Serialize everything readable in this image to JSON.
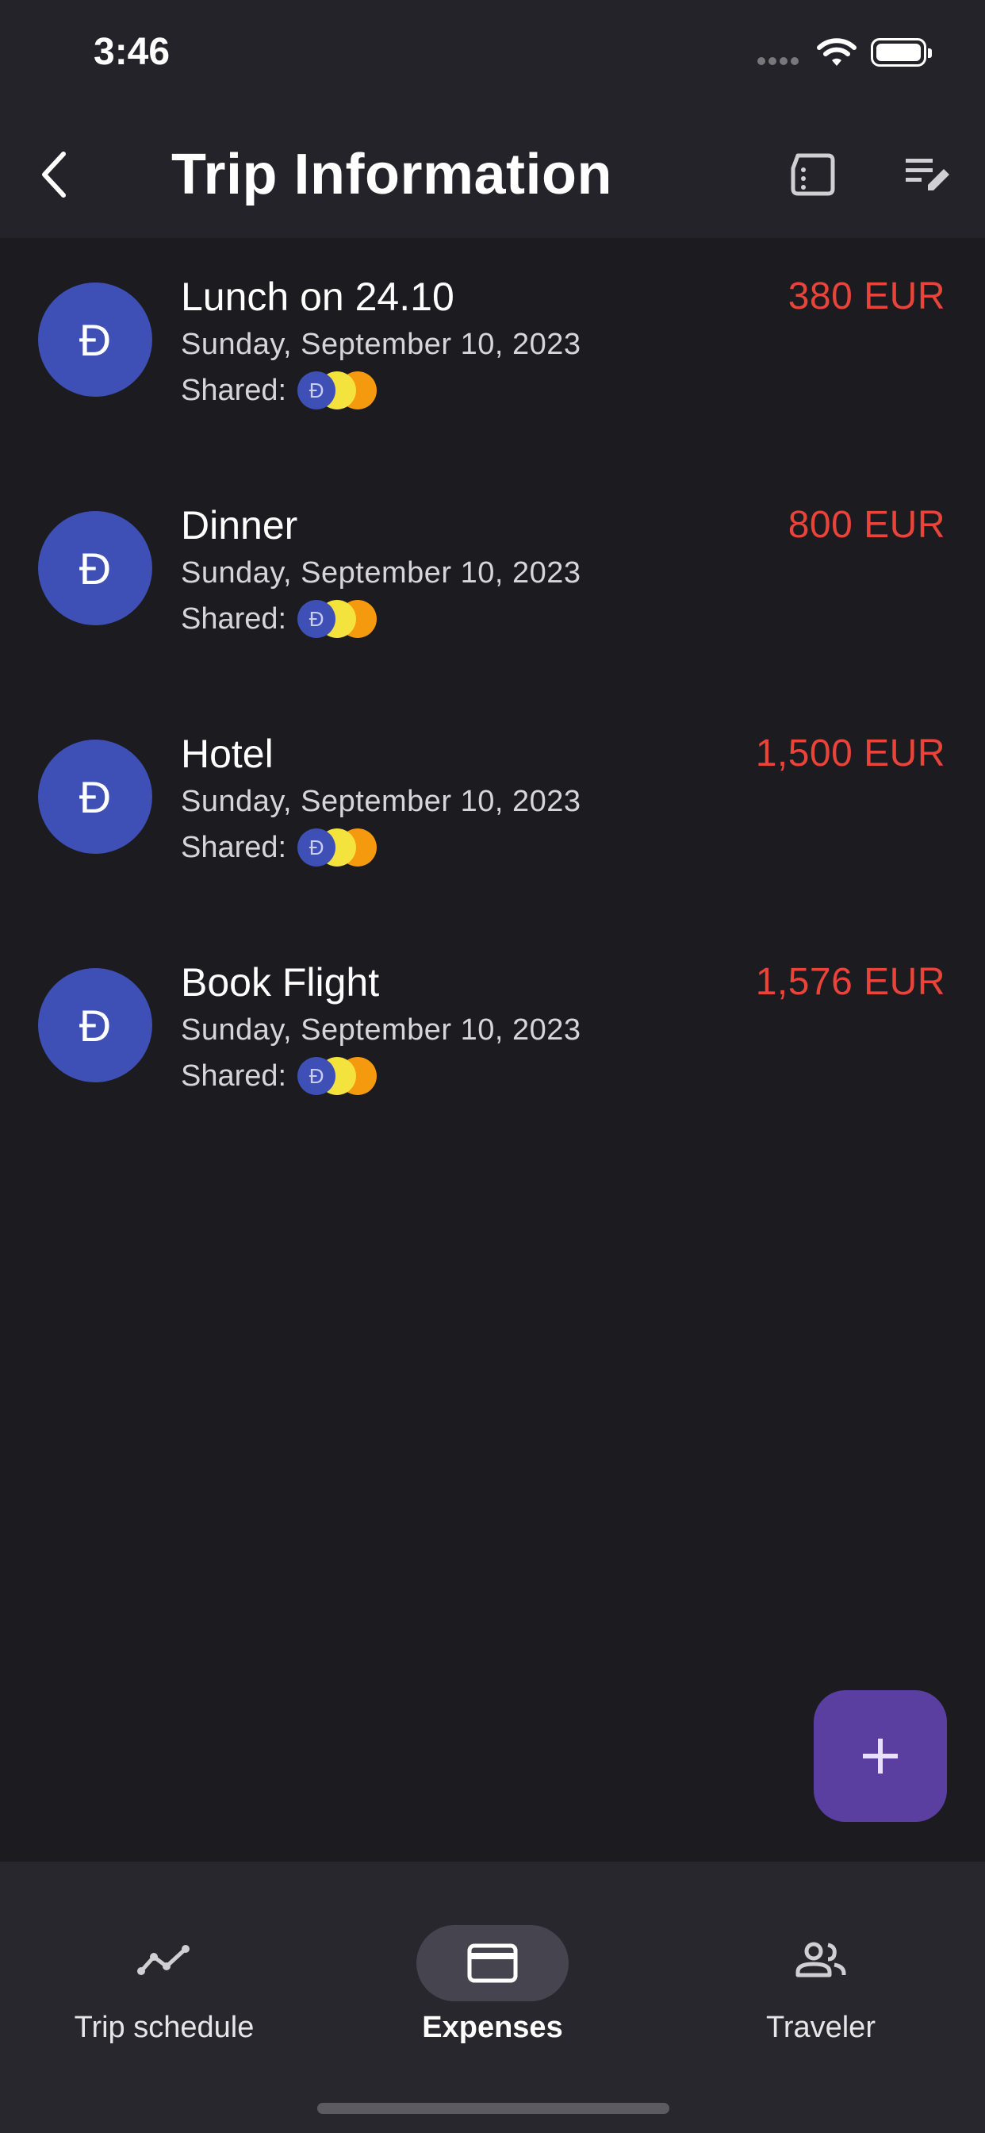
{
  "status_bar": {
    "time": "3:46"
  },
  "app_bar": {
    "title": "Trip Information",
    "icons": [
      "back-arrow-icon",
      "document-icon",
      "edit-list-icon"
    ]
  },
  "expenses": [
    {
      "avatar": "Đ",
      "name": "Lunch on 24.10",
      "date": "Sunday, September 10, 2023",
      "shared_label": "Shared:",
      "amount": "380 EUR"
    },
    {
      "avatar": "Đ",
      "name": "Dinner",
      "date": "Sunday, September 10, 2023",
      "shared_label": "Shared:",
      "amount": "800 EUR"
    },
    {
      "avatar": "Đ",
      "name": "Hotel",
      "date": "Sunday, September 10, 2023",
      "shared_label": "Shared:",
      "amount": "1,500 EUR"
    },
    {
      "avatar": "Đ",
      "name": "Book Flight",
      "date": "Sunday, September 10, 2023",
      "shared_label": "Shared:",
      "amount": "1,576 EUR"
    }
  ],
  "shared_chips": [
    {
      "label": "Đ",
      "color": "#3e4fb5"
    },
    {
      "label": "",
      "color": "#f3e33c"
    },
    {
      "label": "",
      "color": "#f59a0e"
    }
  ],
  "fab": {
    "icon": "plus-icon",
    "color": "#5a3fa0"
  },
  "bottom_nav": {
    "items": [
      {
        "label": "Trip schedule",
        "icon": "timeline-icon",
        "active": false
      },
      {
        "label": "Expenses",
        "icon": "credit-card-icon",
        "active": true
      },
      {
        "label": "Traveler",
        "icon": "people-icon",
        "active": false
      }
    ]
  },
  "colors": {
    "background": "#1c1b20",
    "bar": "#242329",
    "amount": "#e8443a",
    "avatar": "#3e4fb5"
  }
}
